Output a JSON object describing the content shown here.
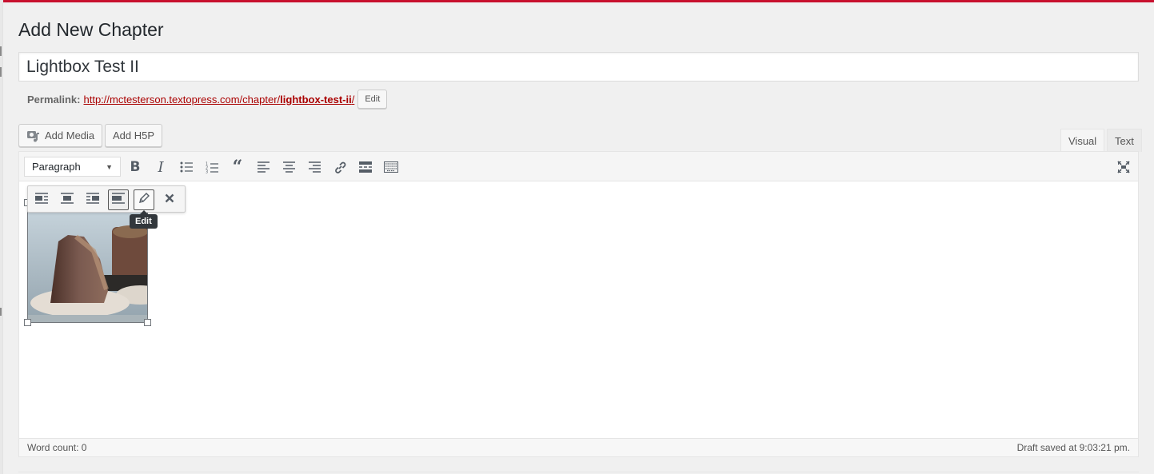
{
  "page": {
    "title": "Add New Chapter",
    "accent_color": "#c8102e"
  },
  "post": {
    "title_value": "Lightbox Test II",
    "permalink_label": "Permalink:",
    "permalink_base": "http://mctesterson.textopress.com/chapter/",
    "permalink_slug": "lightbox-test-ii",
    "permalink_trailing": "/",
    "permalink_edit_label": "Edit"
  },
  "media_buttons": {
    "add_media_label": "Add Media",
    "add_h5p_label": "Add H5P"
  },
  "editor_tabs": {
    "visual_label": "Visual",
    "text_label": "Text",
    "active": "Visual"
  },
  "toolbar": {
    "format_value": "Paragraph",
    "buttons": [
      "bold-icon",
      "italic-icon",
      "bulleted-list-icon",
      "numbered-list-icon",
      "blockquote-icon",
      "align-left-icon",
      "align-center-icon",
      "align-right-icon",
      "link-icon",
      "read-more-icon",
      "toolbar-toggle-icon"
    ],
    "fullscreen": "fullscreen-icon"
  },
  "image_toolbar": {
    "buttons": [
      "align-left-icon",
      "align-center-icon",
      "align-right-icon",
      "align-none-icon",
      "edit-icon",
      "remove-icon"
    ],
    "pressed": "align-none-icon",
    "tooltip": "Edit"
  },
  "status": {
    "word_count": "Word count: 0",
    "draft_saved": "Draft saved at 9:03:21 pm."
  }
}
